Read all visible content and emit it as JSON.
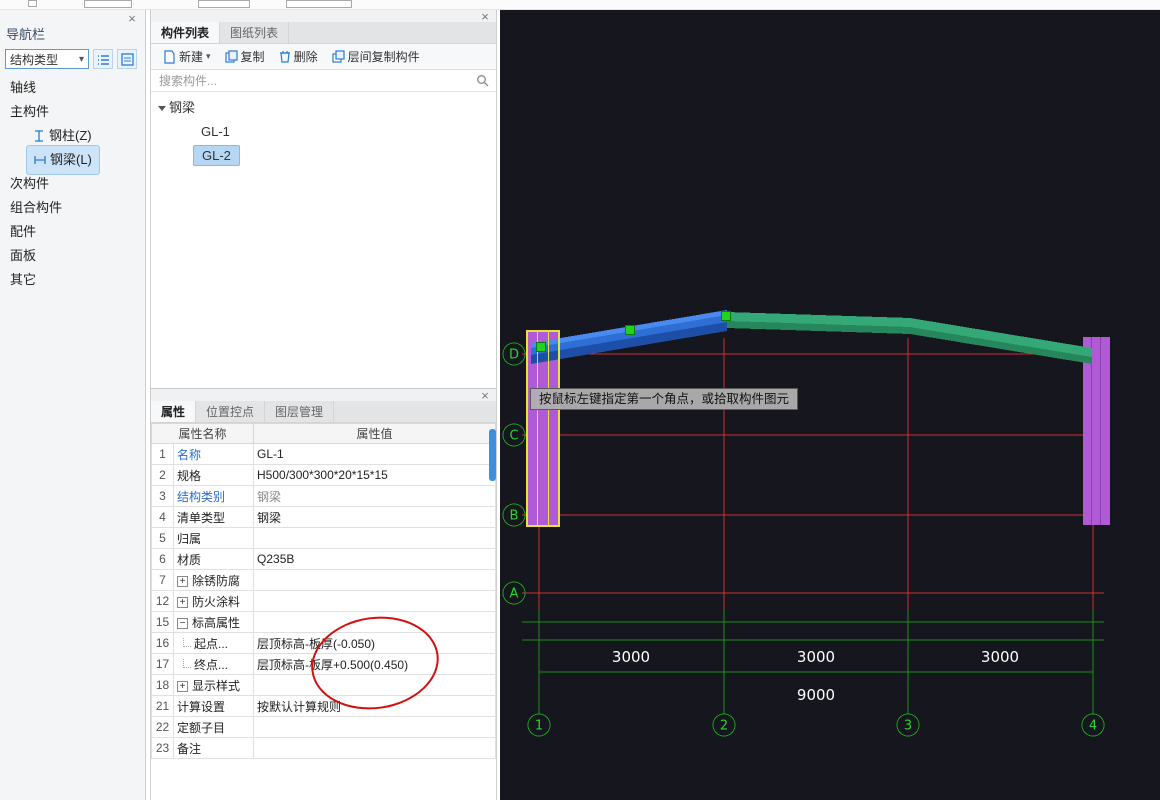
{
  "ui": {
    "close_glyph": "×",
    "caret_glyph": "▾"
  },
  "left_panel": {
    "title": "导航栏",
    "type_selector": "结构类型",
    "items": [
      {
        "label": "轴线"
      },
      {
        "label": "主构件"
      },
      {
        "label": "钢柱(Z)"
      },
      {
        "label": "钢梁(L)"
      },
      {
        "label": "次构件"
      },
      {
        "label": "组合构件"
      },
      {
        "label": "配件"
      },
      {
        "label": "面板"
      },
      {
        "label": "其它"
      }
    ]
  },
  "component_panel": {
    "tabs": [
      "构件列表",
      "图纸列表"
    ],
    "toolbar": {
      "new_label": "新建",
      "copy_label": "复制",
      "delete_label": "删除",
      "interlayer_copy_label": "层间复制构件"
    },
    "search_placeholder": "搜索构件...",
    "tree": {
      "group": "钢梁",
      "items": [
        "GL-1",
        "GL-2"
      ],
      "selected": "GL-2"
    }
  },
  "properties_panel": {
    "tabs": [
      "属性",
      "位置控点",
      "图层管理"
    ],
    "columns": [
      "属性名称",
      "属性值"
    ],
    "rows": [
      {
        "num": "1",
        "name": "名称",
        "value": "GL-1"
      },
      {
        "num": "2",
        "name": "规格",
        "value": "H500/300*300*20*15*15"
      },
      {
        "num": "3",
        "name": "结构类别",
        "value": "钢梁"
      },
      {
        "num": "4",
        "name": "清单类型",
        "value": "钢梁"
      },
      {
        "num": "5",
        "name": "归属",
        "value": ""
      },
      {
        "num": "6",
        "name": "材质",
        "value": "Q235B"
      },
      {
        "num": "7",
        "name": "除锈防腐",
        "value": "",
        "expand": "+"
      },
      {
        "num": "12",
        "name": "防火涂料",
        "value": "",
        "expand": "+"
      },
      {
        "num": "15",
        "name": "标高属性",
        "value": "",
        "expand": "−"
      },
      {
        "num": "16",
        "name": "起点...",
        "value": "层顶标高-板厚(-0.050)"
      },
      {
        "num": "17",
        "name": "终点...",
        "value": "层顶标高-板厚+0.500(0.450)"
      },
      {
        "num": "18",
        "name": "显示样式",
        "value": "",
        "expand": "+"
      },
      {
        "num": "21",
        "name": "计算设置",
        "value": "按默认计算规则"
      },
      {
        "num": "22",
        "name": "定额子目",
        "value": ""
      },
      {
        "num": "23",
        "name": "备注",
        "value": ""
      }
    ]
  },
  "viewport": {
    "tooltip": "按鼠标左键指定第一个角点，或拾取构件图元",
    "row_labels": [
      "D",
      "C",
      "B",
      "A"
    ],
    "col_labels": [
      "1",
      "2",
      "3",
      "4"
    ],
    "dim_labels": [
      "3000",
      "3000",
      "3000"
    ],
    "total_dim": "9000",
    "colors": {
      "beam_blue": "#2e6fd6",
      "beam_green": "#35a877",
      "column_purple": "#b15ad6",
      "grid_red": "#d03030",
      "axis_green": "#22b322",
      "selection_yellow": "#ece13c",
      "grip_green": "#21d321",
      "accent_blue": "#2b7cd3"
    }
  }
}
